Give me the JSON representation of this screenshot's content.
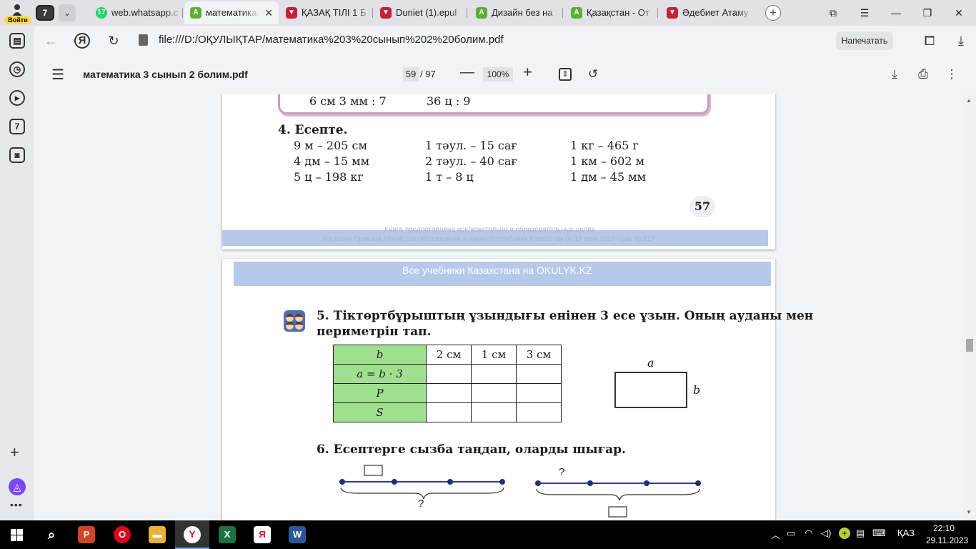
{
  "profile": {
    "login_label": "Войти"
  },
  "tabbar": {
    "tab_count": "7",
    "tabs": [
      {
        "title": "web.whatsapp.c",
        "icon": "whatsapp-icon",
        "icon_color": "#25d366",
        "icon_text": "17"
      },
      {
        "title": "математика",
        "icon": "alice-icon",
        "icon_color": "#5ab031",
        "icon_text": "A",
        "active": true
      },
      {
        "title": "ҚАЗАҚ ТІЛІ 1 Б",
        "icon": "epub-reader-icon",
        "icon_color": "#c3213a",
        "icon_text": "▼"
      },
      {
        "title": "Duniet (1).epul",
        "icon": "epub-reader-icon",
        "icon_color": "#c3213a",
        "icon_text": "▼"
      },
      {
        "title": "Дизайн без на",
        "icon": "alice-icon",
        "icon_color": "#5ab031",
        "icon_text": "A"
      },
      {
        "title": "Қазақстан - От",
        "icon": "alice-icon",
        "icon_color": "#5ab031",
        "icon_text": "A"
      },
      {
        "title": "Әдебиет Атаму",
        "icon": "epub-reader-icon",
        "icon_color": "#c3213a",
        "icon_text": "▼"
      }
    ]
  },
  "sidebar": {
    "badge": "7"
  },
  "navbar": {
    "url": "file:///D:/ОҚУЛЫҚТАР/математика%203%20сынып%202%20болим.pdf",
    "print_label": "Напечатать"
  },
  "pdf": {
    "title": "математика 3 сынып 2 болим.pdf",
    "page_current": "59",
    "page_total": "/ 97",
    "zoom": "100%"
  },
  "page_a": {
    "frame_left": "6 см 3 мм : 7",
    "frame_right": "36 ц  : 9",
    "task4_head": "4. Есепте.",
    "task4_rows": [
      [
        "9 м – 205 см",
        "1 тәул. – 15 сағ",
        "1 кг – 465 г"
      ],
      [
        "4 дм – 15 мм",
        "2 тәул. – 40 сағ",
        "1 км – 602 м"
      ],
      [
        "5 ц – 198 кг",
        "1 т – 8 ц",
        "1 дм – 45 мм"
      ]
    ],
    "page_number": "57",
    "footer_line1": "Книга предоставлена исключительно в образовательных целях",
    "footer_line2": "согласно Приказа Министра образования и науки Республики Казахстан от 17 мая 2019 года № 217"
  },
  "page_b": {
    "header": "Все учебники Казахстана на OKULYK.KZ",
    "task5_line1": "5. Тіктөртбұрыштың ұзындығы енінен 3 есе ұзын. Оның ауданы мен",
    "task5_line2": "периметрін тап.",
    "table_header": [
      "b",
      "2 см",
      "1 см",
      "3 см"
    ],
    "table_rows": [
      "a = b · 3",
      "P",
      "S"
    ],
    "rect_top_label": "a",
    "rect_side_label": "b",
    "task6": "6. Есептерге сызба таңдап, оларды шығар.",
    "q": "?"
  },
  "taskbar": {
    "apps": [
      {
        "name": "powerpoint-icon",
        "color": "#d04423",
        "text": "P"
      },
      {
        "name": "opera-icon",
        "color": "#e0001b",
        "text": "O"
      },
      {
        "name": "file-explorer-icon",
        "color": "#e8b23a",
        "text": "▬"
      },
      {
        "name": "yandex-browser-icon",
        "color": "#ffffff",
        "text": "Y"
      },
      {
        "name": "excel-icon",
        "color": "#1d7044",
        "text": "X"
      },
      {
        "name": "yandex-icon",
        "color": "#ffffff",
        "text": "Я"
      },
      {
        "name": "word-icon",
        "color": "#2b579a",
        "text": "W"
      }
    ],
    "lang": "ҚАЗ",
    "time": "22:10",
    "date": "29.11.2023"
  }
}
